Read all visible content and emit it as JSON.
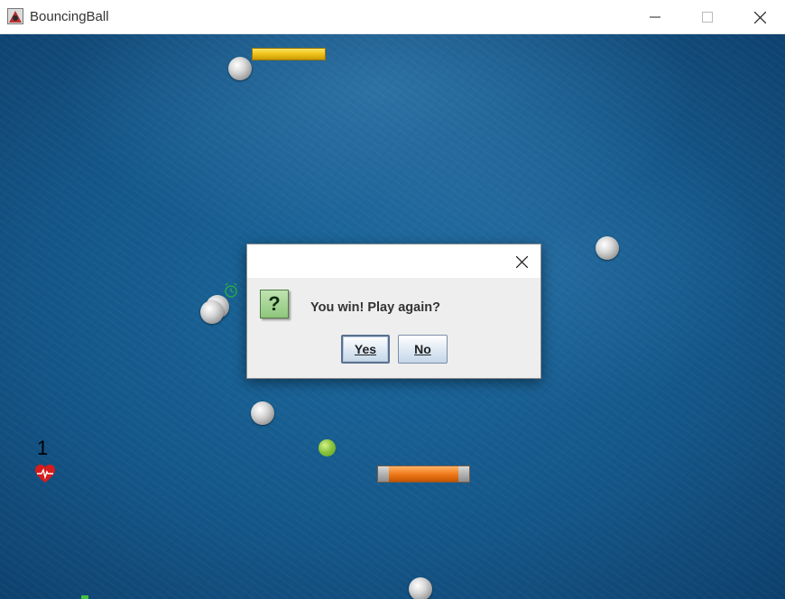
{
  "window": {
    "title": "BouncingBall",
    "controls": {
      "minimize": "minimize-icon",
      "maximize": "maximize-icon",
      "close": "close-icon"
    }
  },
  "game": {
    "lives": "1",
    "lives_icon": "heart-icon",
    "powerup_icon": "clock-icon",
    "colors": {
      "background": "#155a8c",
      "paddle": "#f07a1a",
      "gold_brick": "#f2c51c",
      "ball": "#8cc63f",
      "obstacles": "#c0c0c0"
    }
  },
  "dialog": {
    "message": "You win! Play again?",
    "icon": "question-icon",
    "icon_glyph": "?",
    "yes_label": "Yes",
    "no_label": "No"
  }
}
